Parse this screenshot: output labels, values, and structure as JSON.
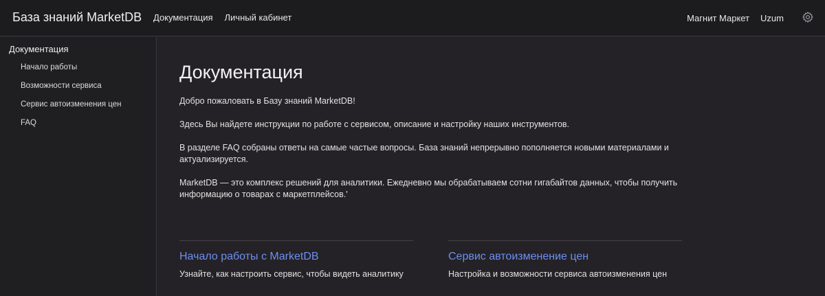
{
  "header": {
    "brand": "База знаний MarketDB",
    "nav": [
      "Документация",
      "Личный кабинет"
    ],
    "right_links": [
      "Магнит Маркет",
      "Uzum"
    ],
    "settings_icon": "gear-icon"
  },
  "sidebar": {
    "section_title": "Документация",
    "items": [
      "Начало работы",
      "Возможности сервиса",
      "Сервис автоизменения цен",
      "FAQ"
    ]
  },
  "main": {
    "title": "Документация",
    "paragraphs": [
      "Добро пожаловать в Базу знаний MarketDB!",
      "Здесь Вы найдете инструкции по работе с сервисом, описание и настройку наших инструментов.",
      "В разделе FAQ собраны ответы на самые частые вопросы. База знаний непрерывно пополняется новыми материалами и актуализируется.",
      "MarketDB — это комплекс решений для аналитики. Ежедневно мы обрабатываем сотни гигабайтов данных, чтобы получить информацию о товарах с маркетплейсов.'"
    ],
    "cards": [
      {
        "title": "Начало работы с MarketDB",
        "description": "Узнайте, как настроить сервис, чтобы видеть аналитику"
      },
      {
        "title": "Сервис автоизменение цен",
        "description": "Настройка и возможности сервиса автоизменения цен"
      }
    ]
  },
  "colors": {
    "background": "#242226",
    "topbar": "#1c1b1e",
    "sidebar": "#1f1e21",
    "link_accent": "#6e8ff0"
  }
}
